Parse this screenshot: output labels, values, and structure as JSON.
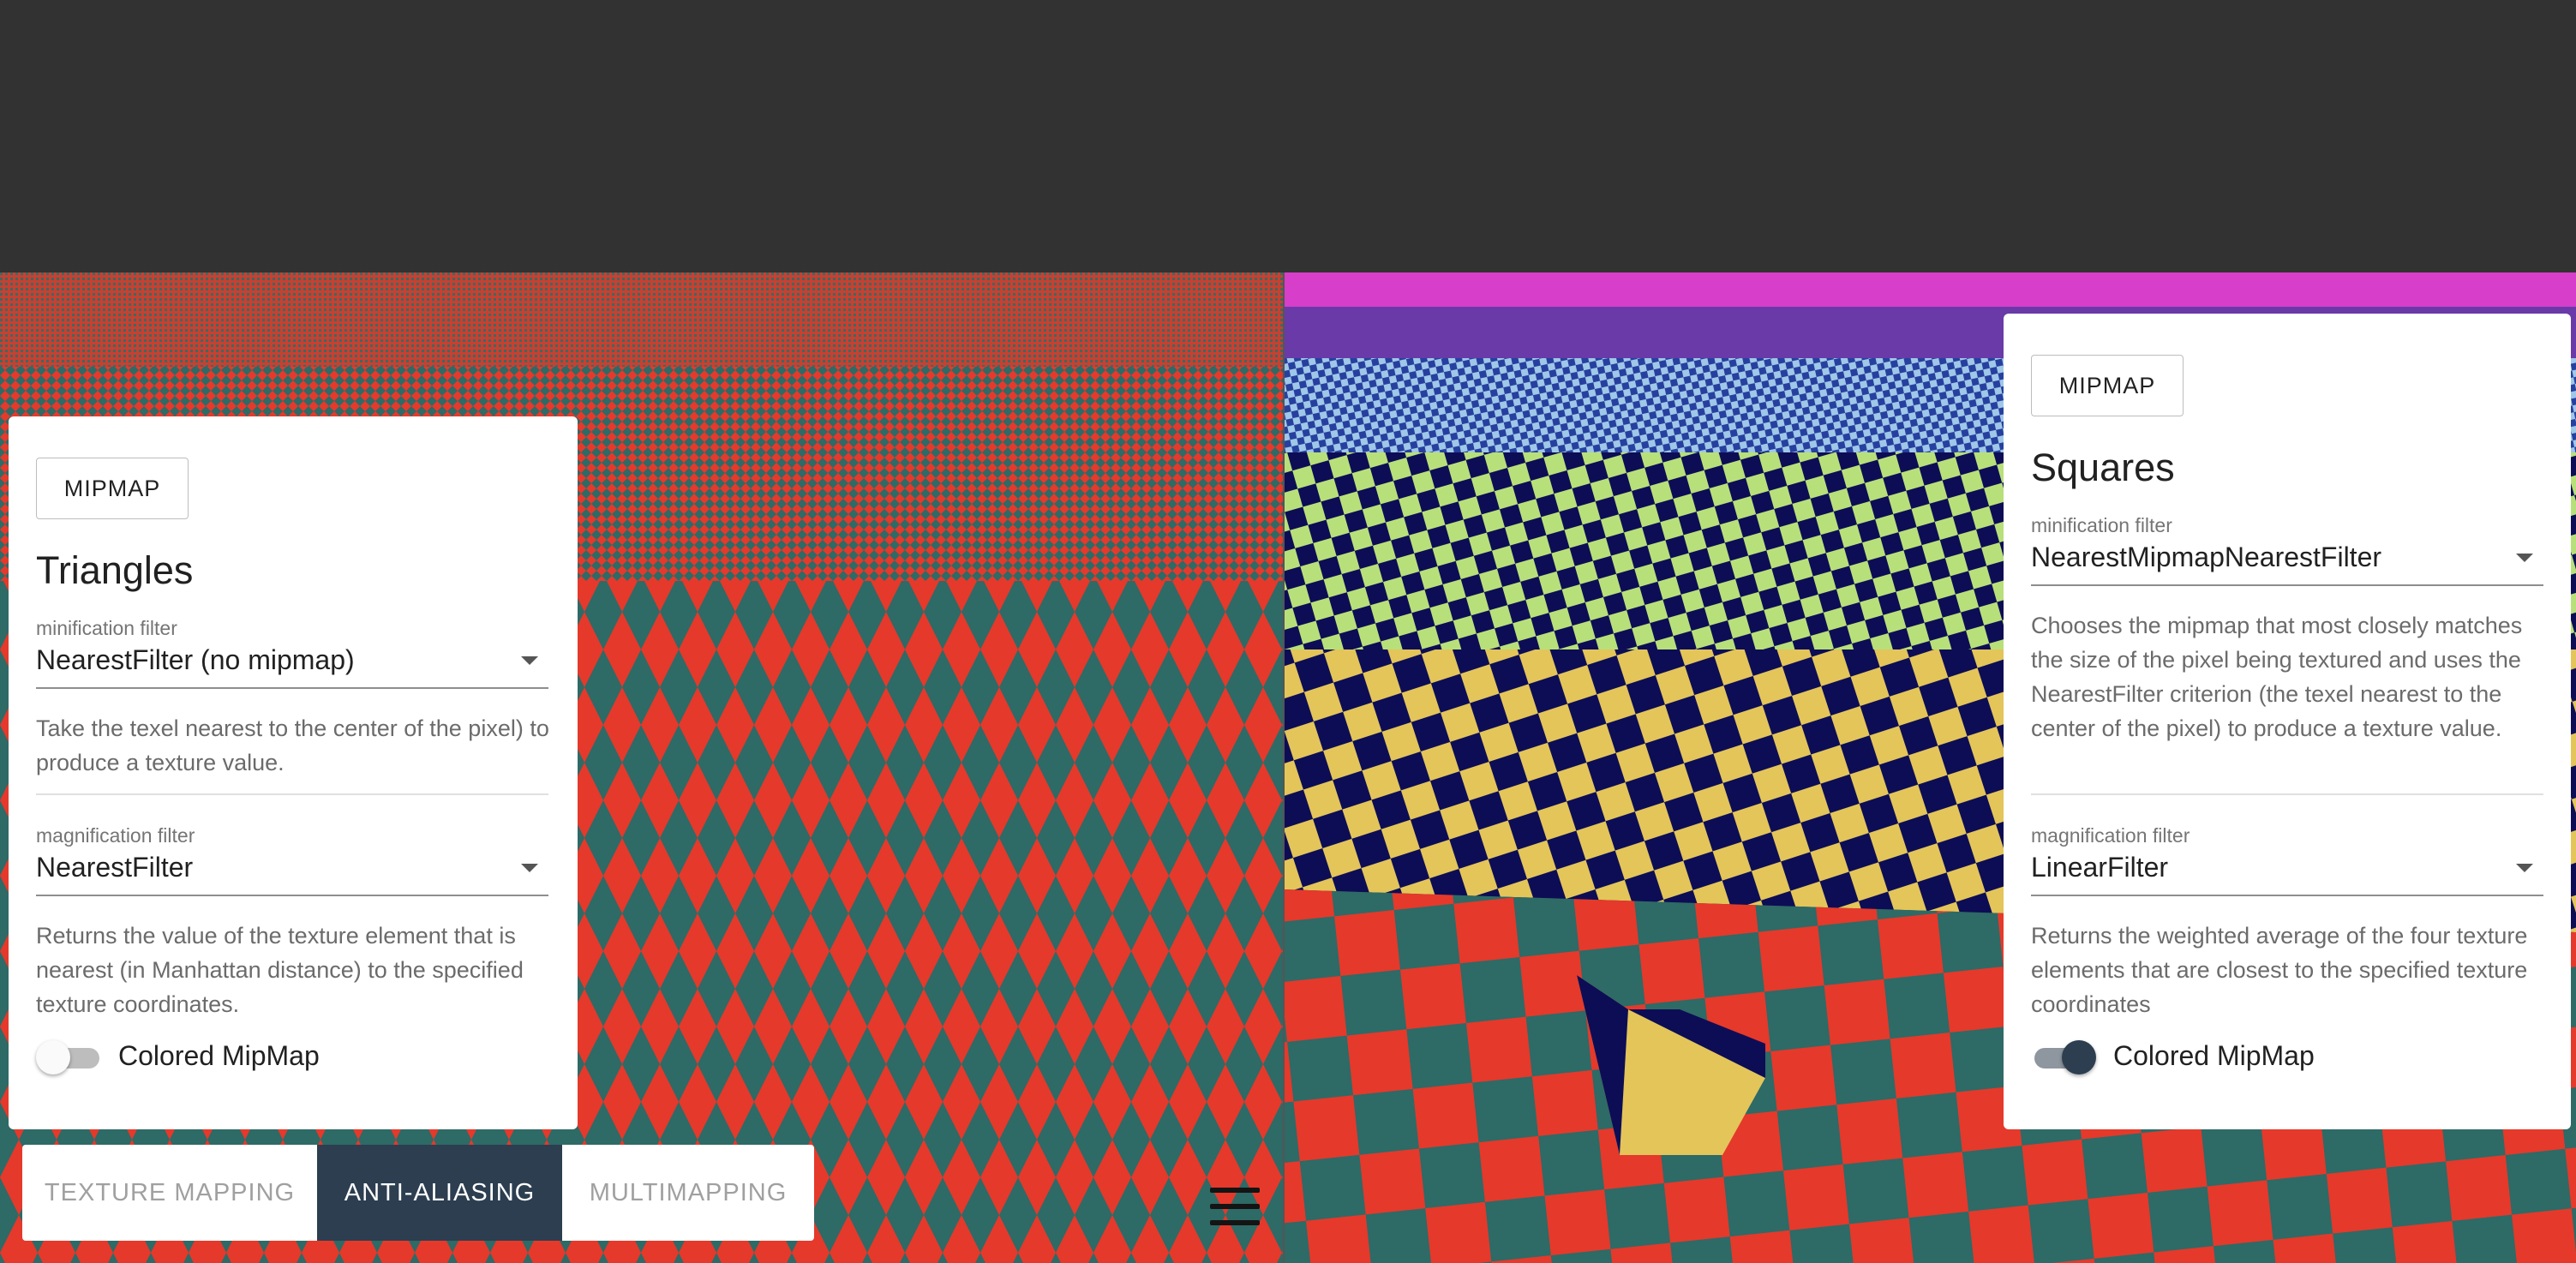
{
  "colors": {
    "topbar": "#323232",
    "tab_active_bg": "#2c3e50",
    "triangle_red": "#e5392b",
    "triangle_teal": "#2e6a66",
    "checker_navy": "#0d0d55",
    "checker_yellow": "#e3c55a",
    "checker_lime": "#b8e07a",
    "sky_magenta": "#d73ec9",
    "sky_blue": "#27409f"
  },
  "left_panel": {
    "mipmap_button": "MIPMAP",
    "title": "Triangles",
    "min_label": "minification filter",
    "min_value": "NearestFilter (no mipmap)",
    "min_description": "Take the texel nearest to the center of the pixel) to produce a texture value.",
    "mag_label": "magnification filter",
    "mag_value": "NearestFilter",
    "mag_description": "Returns the value of the texture element that is nearest (in Manhattan distance) to the specified texture coordinates.",
    "toggle_label": "Colored MipMap",
    "toggle_on": false
  },
  "right_panel": {
    "mipmap_button": "MIPMAP",
    "title": "Squares",
    "min_label": "minification filter",
    "min_value": "NearestMipmapNearestFilter",
    "min_description": "Chooses the mipmap that most closely matches the size of the pixel being textured and uses the NearestFilter criterion (the texel nearest to the center of the pixel) to produce a texture value.",
    "mag_label": "magnification filter",
    "mag_value": "LinearFilter",
    "mag_description": "Returns the weighted average of the four texture elements that are closest to the specified texture coordinates",
    "toggle_label": "Colored MipMap",
    "toggle_on": true
  },
  "tabs": [
    {
      "label": "TEXTURE MAPPING",
      "active": false
    },
    {
      "label": "ANTI-ALIASING",
      "active": true
    },
    {
      "label": "MULTIMAPPING",
      "active": false
    }
  ],
  "icons": {
    "menu": "hamburger-icon"
  }
}
